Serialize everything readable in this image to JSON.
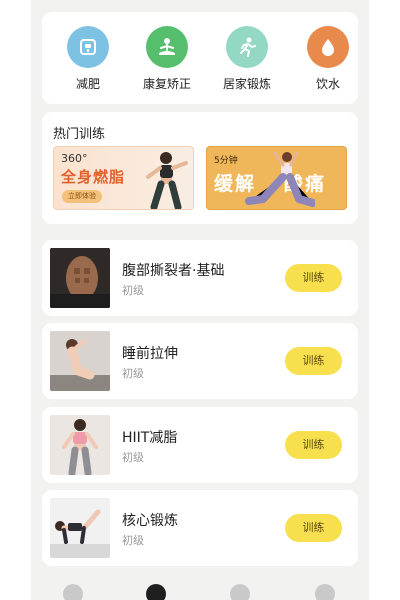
{
  "categories": [
    {
      "label": "减肥",
      "icon": "scale-icon",
      "color": "#7ec2e3"
    },
    {
      "label": "康复矫正",
      "icon": "meditation-icon",
      "color": "#55bf6d"
    },
    {
      "label": "居家锻炼",
      "icon": "running-icon",
      "color": "#93d8c4"
    },
    {
      "label": "饮水",
      "icon": "water-drop-icon",
      "color": "#e88a4b"
    }
  ],
  "hot": {
    "title": "热门训练",
    "banner1": {
      "top": "360°",
      "main": "全身燃脂",
      "button": "立即体验"
    },
    "banner2": {
      "top": "5分钟",
      "main_left": "缓解",
      "main_right": "酸痛"
    }
  },
  "workouts": [
    {
      "name": "腹部撕裂者·基础",
      "level": "初级",
      "button": "训练"
    },
    {
      "name": "睡前拉伸",
      "level": "初级",
      "button": "训练"
    },
    {
      "name": "HIIT减脂",
      "level": "初级",
      "button": "训练"
    },
    {
      "name": "核心锻炼",
      "level": "初级",
      "button": "训练"
    }
  ],
  "nav": [
    {
      "icon": "home-icon"
    },
    {
      "icon": "training-icon"
    },
    {
      "icon": "location-icon"
    },
    {
      "icon": "profile-icon"
    }
  ],
  "colors": {
    "accent_button": "#f7df4e",
    "banner_orange": "#f0b65a",
    "highlight_text": "#e2622d"
  }
}
